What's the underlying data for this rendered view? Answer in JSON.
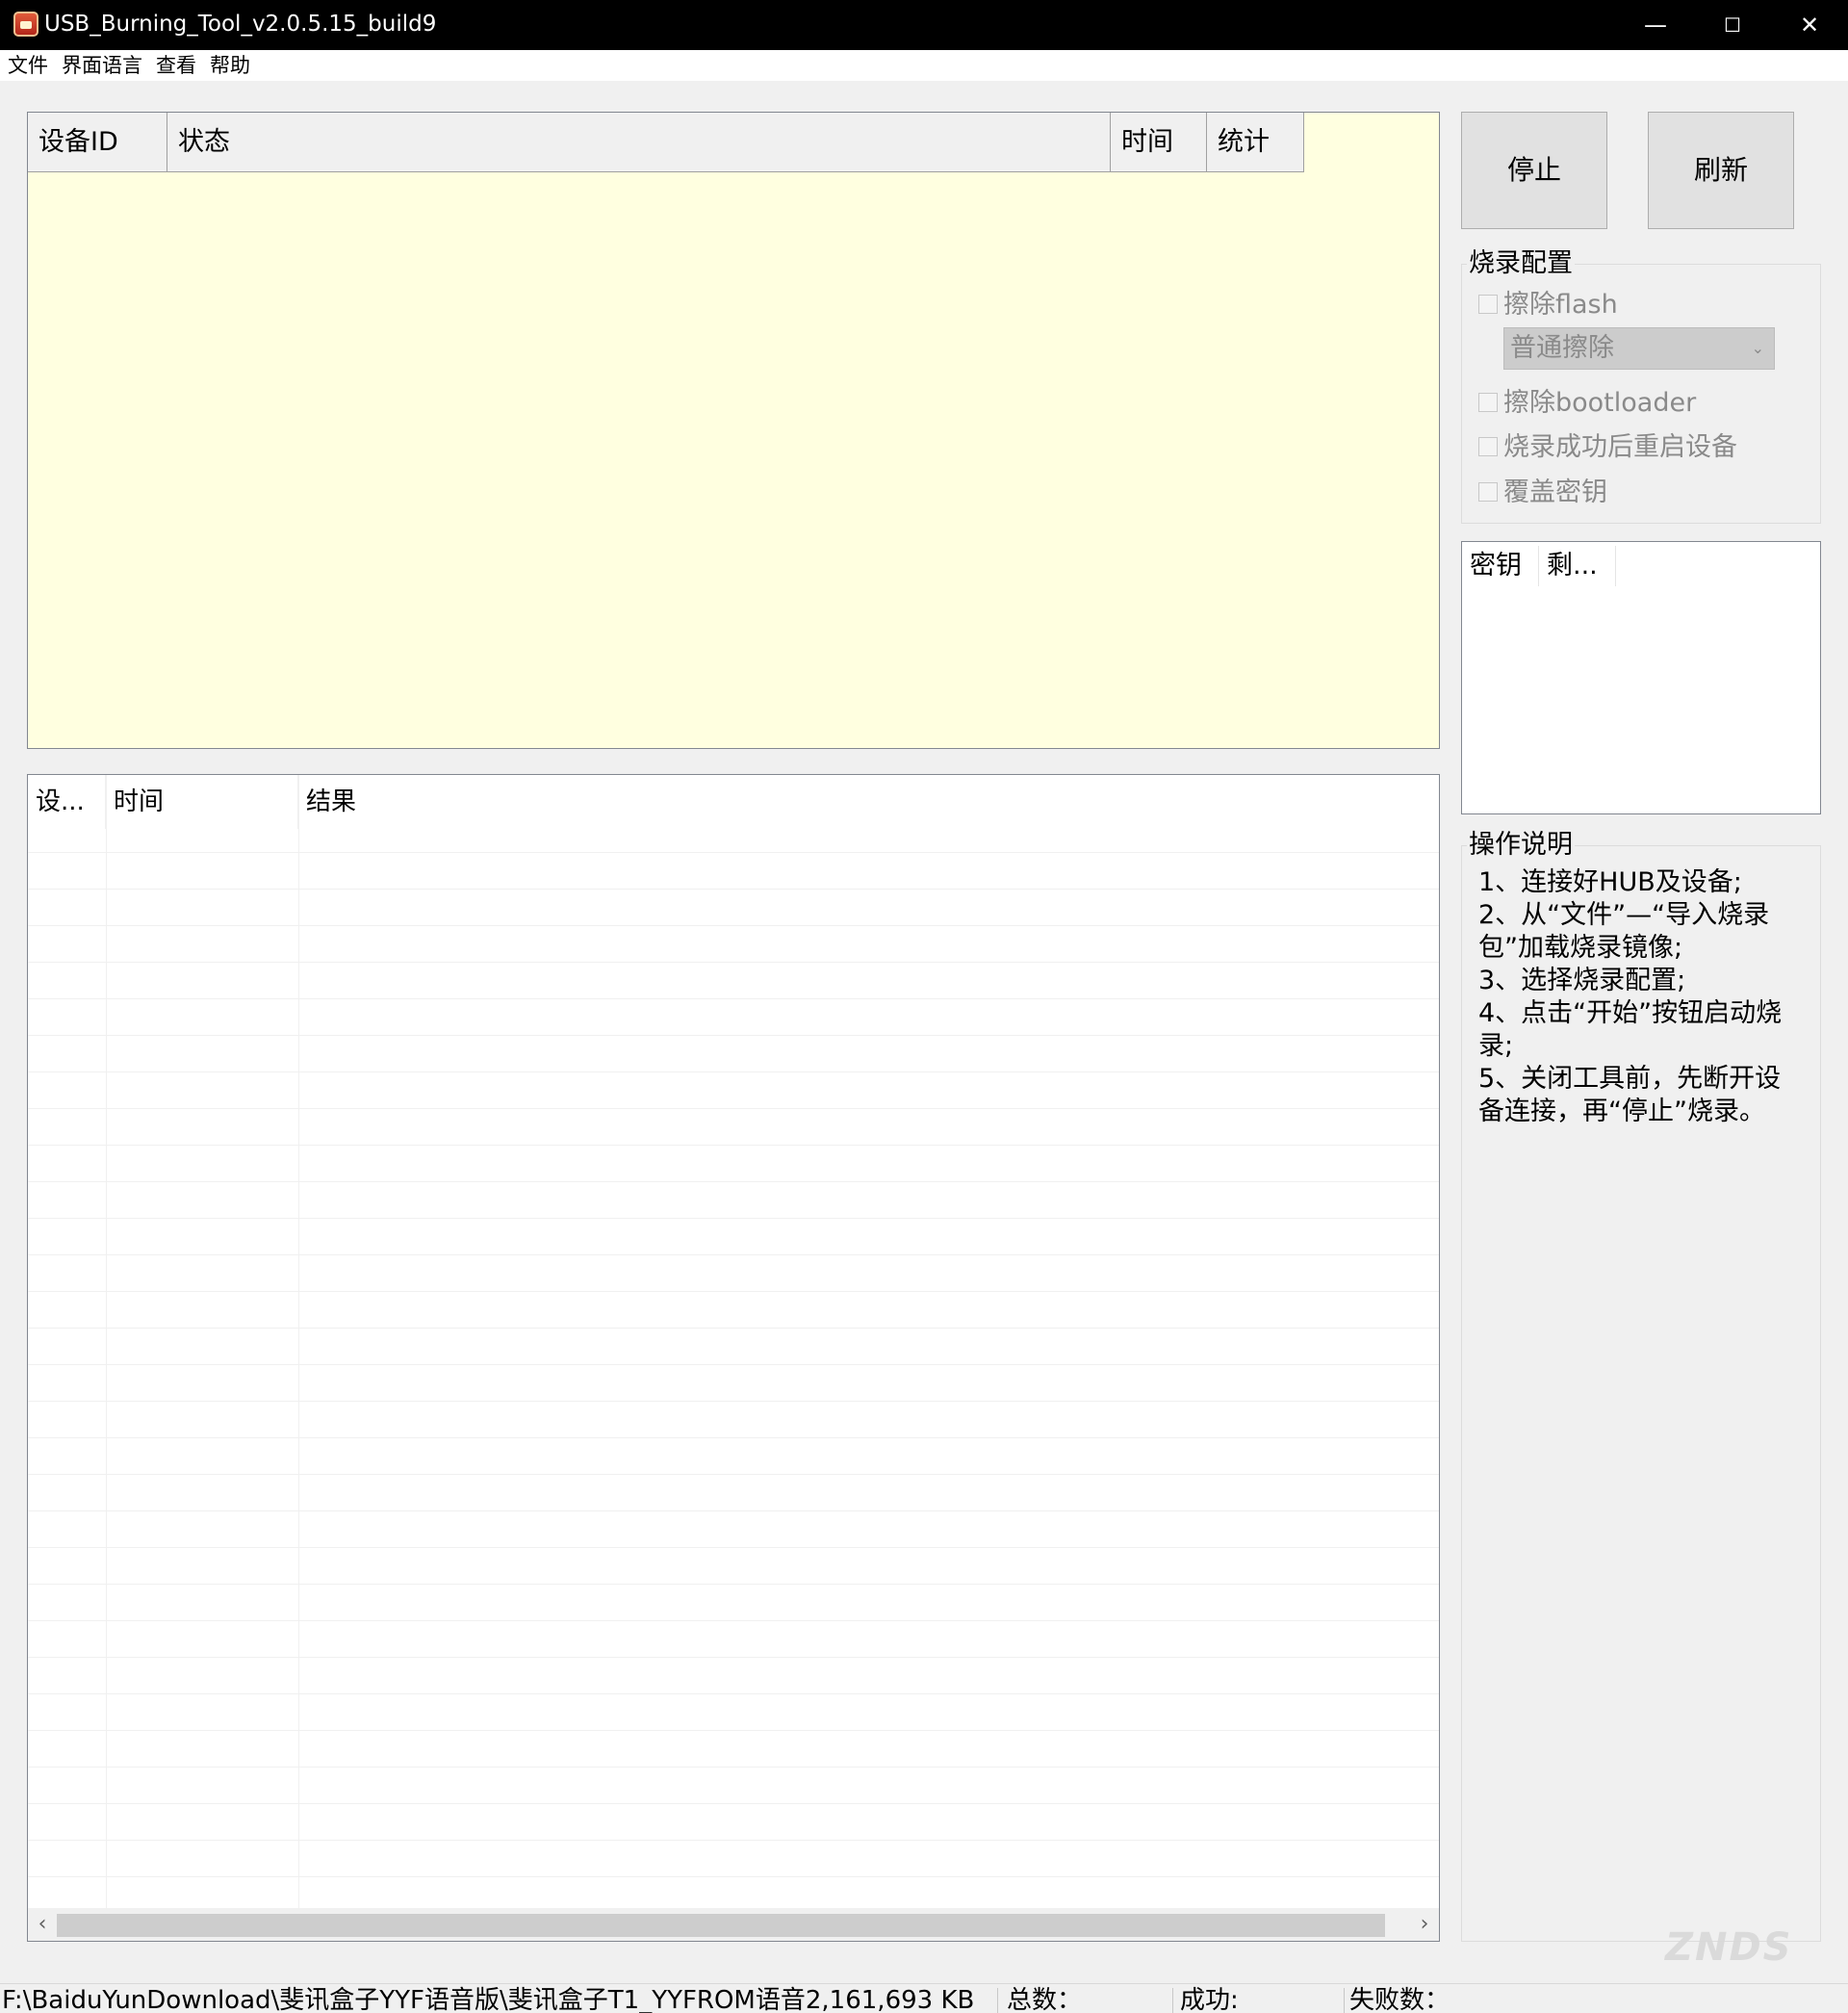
{
  "window": {
    "title": "USB_Burning_Tool_v2.0.5.15_build9",
    "minimize_glyph": "—",
    "maximize_glyph": "☐",
    "close_glyph": "✕"
  },
  "menu": {
    "items": [
      "文件",
      "界面语言",
      "查看",
      "帮助"
    ]
  },
  "device_table": {
    "columns": [
      "设备ID",
      "状态",
      "时间",
      "统计"
    ],
    "background": "#ffffe0"
  },
  "log_table": {
    "columns": [
      "设...",
      "时间",
      "结果"
    ],
    "scroll_left": "‹",
    "scroll_right": "›"
  },
  "buttons": {
    "stop": "停止",
    "refresh": "刷新"
  },
  "burn_config": {
    "title": "烧录配置",
    "erase_flash": "擦除flash",
    "erase_mode": "普通擦除",
    "erase_mode_arrow": "⌄",
    "erase_bootloader": "擦除bootloader",
    "reboot_after": "烧录成功后重启设备",
    "overwrite_key": "覆盖密钥"
  },
  "key_list": {
    "columns": [
      "密钥",
      "剩..."
    ]
  },
  "instructions": {
    "title": "操作说明",
    "lines": [
      "1、连接好HUB及设备;",
      "2、从“文件”—“导入烧录包”加载烧录镜像;",
      "3、选择烧录配置;",
      "4、点击“开始”按钮启动烧录;",
      "5、关闭工具前，先断开设备连接，再“停止”烧录。"
    ]
  },
  "status_bar": {
    "path_size": "F:\\BaiduYunDownload\\斐讯盒子YYF语音版\\斐讯盒子T1_YYFROM语音2,161,693 KB",
    "total_label": "总数：",
    "success_label": "成功:",
    "fail_label": "失败数："
  },
  "watermark": {
    "text": "ZNDS"
  }
}
